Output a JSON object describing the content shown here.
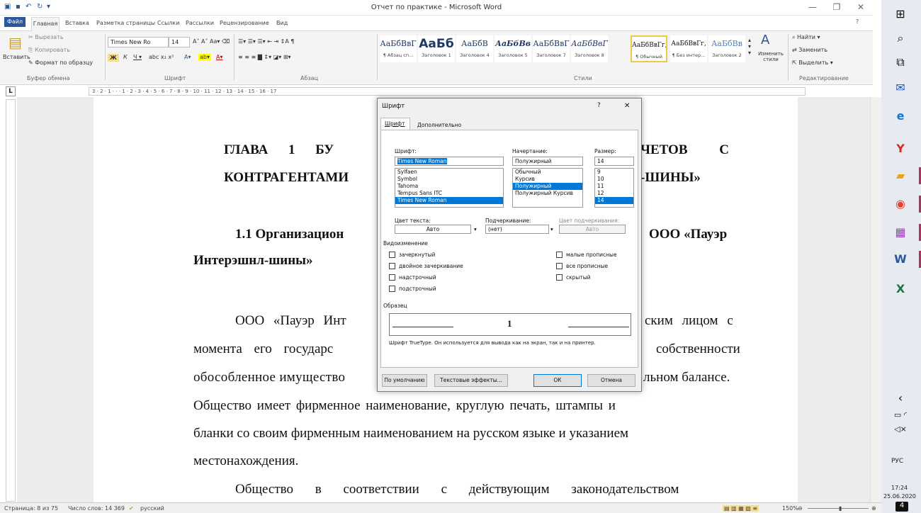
{
  "window": {
    "title": "Отчет по практике - Microsoft Word"
  },
  "tabs": [
    "Файл",
    "Главная",
    "Вставка",
    "Разметка страницы",
    "Ссылки",
    "Рассылки",
    "Рецензирование",
    "Вид"
  ],
  "ribbon": {
    "clipboard": {
      "paste": "Вставить",
      "cut": "Вырезать",
      "copy": "Копировать",
      "format_painter": "Формат по образцу",
      "label": "Буфер обмена"
    },
    "font": {
      "name": "Times New Ro",
      "size": "14",
      "label": "Шрифт"
    },
    "paragraph": {
      "label": "Абзац"
    },
    "styles": {
      "label": "Стили",
      "items": [
        {
          "preview": "АаБбВвГ",
          "name": "¶ Абзац сп..."
        },
        {
          "preview": "АаБб",
          "name": "Заголовок 1"
        },
        {
          "preview": "АаБбВ",
          "name": "Заголовок 4"
        },
        {
          "preview": "АаБбВв",
          "name": "Заголовок 5"
        },
        {
          "preview": "АаБбВвГ",
          "name": "Заголовок 7"
        },
        {
          "preview": "АаБбВвГ",
          "name": "Заголовок 8"
        },
        {
          "preview": "АаБбВвГг,",
          "name": "¶ Обычный"
        },
        {
          "preview": "АаБбВвГг,",
          "name": "¶ Без интер..."
        },
        {
          "preview": "АаБбВв",
          "name": "Заголовок 2"
        }
      ],
      "change": "Изменить стили"
    },
    "editing": {
      "find": "Найти",
      "replace": "Заменить",
      "select": "Выделить",
      "label": "Редактирование"
    }
  },
  "ruler": {
    "marks": "3 · 2 · 1 · · · 1 · 2 · 3 · 4 · 5 · 6 · 7 · 8 · 9 · 10 · 11 · 12 · 13 · 14 · 15 · 16 · 17"
  },
  "document": {
    "heading_l1_left": "ГЛАВА 1 БУ",
    "heading_l1_right": "ЧЕТОВ С",
    "heading_l2_left": "КОНТРАГЕНТАМИ",
    "heading_l2_right": "-ШИНЫ»",
    "sub_l1_left": "1.1 Организацион",
    "sub_l1_right": "ООО «Пауэр",
    "sub_l2": "Интерэшнл-шины»",
    "p1_left": "ООО «Пауэр Инт",
    "p1_right": "ским лицом с",
    "p2_left": "момента его государс",
    "p2_right": "собственности",
    "p3_left": "обособленное имущество",
    "p3_right": "льном балансе.",
    "p4": "Общество имеет фирменное наименование, круглую печать, штампы и",
    "p5": "бланки со своим фирменным наименованием на русском языке и указанием",
    "p6": "местонахождения.",
    "p7": "Общество в соответствии с действующим законодательством"
  },
  "dialog": {
    "title": "Шрифт",
    "help": "?",
    "close": "✕",
    "tab_font": "Шрифт",
    "tab_advanced": "Дополнительно",
    "font_label": "Шрифт:",
    "font_value": "Times New Roman",
    "font_list": [
      "Sylfaen",
      "Symbol",
      "Tahoma",
      "Tempus Sans ITC",
      "Times New Roman"
    ],
    "style_label": "Начертание:",
    "style_value": "Полужирный",
    "style_list": [
      "Обычный",
      "Курсив",
      "Полужирный",
      "Полужирный Курсив"
    ],
    "size_label": "Размер:",
    "size_value": "14",
    "size_list": [
      "9",
      "10",
      "11",
      "12",
      "14"
    ],
    "color_label": "Цвет текста:",
    "color_value": "Авто",
    "underline_label": "Подчеркивание:",
    "underline_value": "(нет)",
    "ucolor_label": "Цвет подчеркивания:",
    "ucolor_value": "Авто",
    "effects_label": "Видоизменение",
    "effects_left": [
      "зачеркнутый",
      "двойное зачеркивание",
      "надстрочный",
      "подстрочный"
    ],
    "effects_right": [
      "малые прописные",
      "все прописные",
      "скрытый"
    ],
    "sample_label": "Образец",
    "sample_text": "1",
    "note": "Шрифт TrueType. Он используется для вывода как на экран, так и на принтер.",
    "btn_default": "По умолчанию",
    "btn_effects": "Текстовые эффекты...",
    "btn_ok": "ОК",
    "btn_cancel": "Отмена"
  },
  "status": {
    "page": "Страница: 8 из 75",
    "words": "Число слов: 14 369",
    "lang": "русский",
    "zoom": "150%"
  },
  "taskbar": {
    "lang": "РУС",
    "time": "17:24",
    "date": "25.06.2020",
    "notif": "4"
  }
}
